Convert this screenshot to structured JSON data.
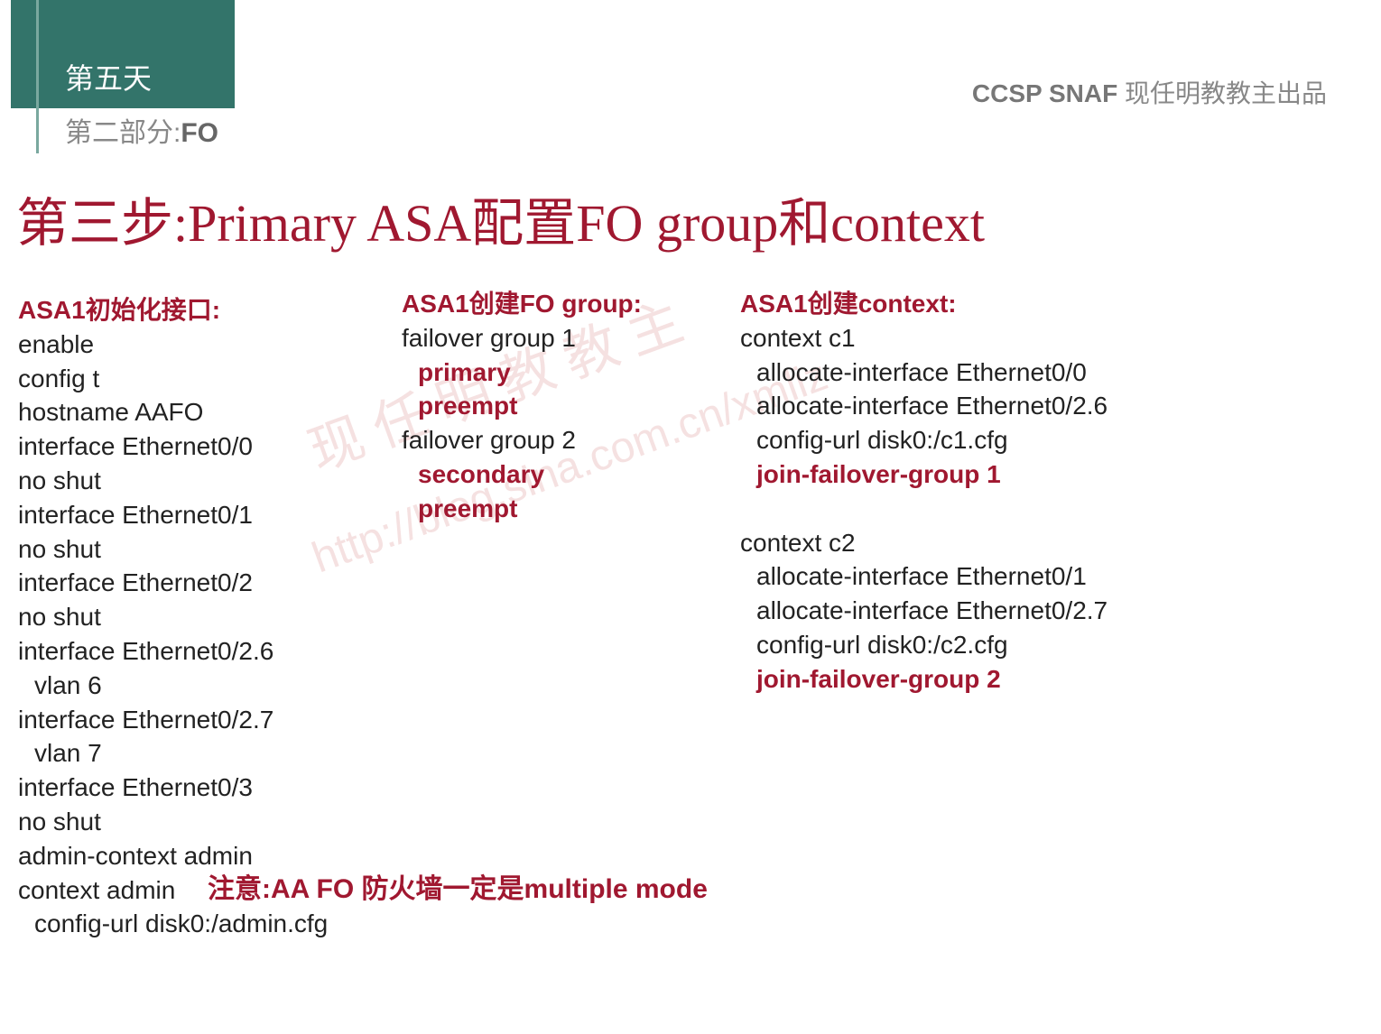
{
  "header": {
    "tab": "第五天",
    "sub": "第二部分:",
    "sub_bold": "FO",
    "right_bold": "CCSP SNAF",
    "right": " 现任明教教主出品"
  },
  "title": "第三步:Primary ASA配置FO group和context",
  "col1": {
    "heading": "ASA1初始化接口:",
    "lines": [
      {
        "text": "enable"
      },
      {
        "text": "config t"
      },
      {
        "text": "hostname AAFO"
      },
      {
        "text": "interface Ethernet0/0"
      },
      {
        "text": "no shut"
      },
      {
        "text": "interface Ethernet0/1"
      },
      {
        "text": "no shut"
      },
      {
        "text": "interface Ethernet0/2"
      },
      {
        "text": "no shut"
      },
      {
        "text": "interface Ethernet0/2.6"
      },
      {
        "text": "vlan 6",
        "indent": true
      },
      {
        "text": "interface Ethernet0/2.7"
      },
      {
        "text": "vlan 7",
        "indent": true
      },
      {
        "text": "interface Ethernet0/3"
      },
      {
        "text": "no shut"
      },
      {
        "text": "admin-context admin"
      },
      {
        "text": "context admin"
      },
      {
        "text": "config-url disk0:/admin.cfg",
        "indent": true
      }
    ]
  },
  "col2": {
    "heading": "ASA1创建FO group:",
    "lines": [
      {
        "text": "failover group 1"
      },
      {
        "text": "primary",
        "indent": true,
        "highlight": true
      },
      {
        "text": "preempt",
        "indent": true,
        "highlight": true
      },
      {
        "text": "failover group 2"
      },
      {
        "text": "secondary",
        "indent": true,
        "highlight": true
      },
      {
        "text": "preempt",
        "indent": true,
        "highlight": true
      }
    ]
  },
  "col3": {
    "heading": "ASA1创建context:",
    "lines": [
      {
        "text": "context c1"
      },
      {
        "text": "allocate-interface Ethernet0/0",
        "indent": true
      },
      {
        "text": "allocate-interface Ethernet0/2.6",
        "indent": true
      },
      {
        "text": "config-url disk0:/c1.cfg",
        "indent": true
      },
      {
        "text": "join-failover-group 1",
        "indent": true,
        "highlight": true
      },
      {
        "text": " "
      },
      {
        "text": "context c2"
      },
      {
        "text": "allocate-interface Ethernet0/1",
        "indent": true
      },
      {
        "text": "allocate-interface Ethernet0/2.7",
        "indent": true
      },
      {
        "text": "config-url disk0:/c2.cfg",
        "indent": true
      },
      {
        "text": "join-failover-group 2",
        "indent": true,
        "highlight": true
      }
    ]
  },
  "footer": "注意:AA FO 防火墙一定是multiple mode",
  "watermark1": "现 任 明 教 教 主",
  "watermark2": "http://blog.sina.com.cn/xmliz"
}
